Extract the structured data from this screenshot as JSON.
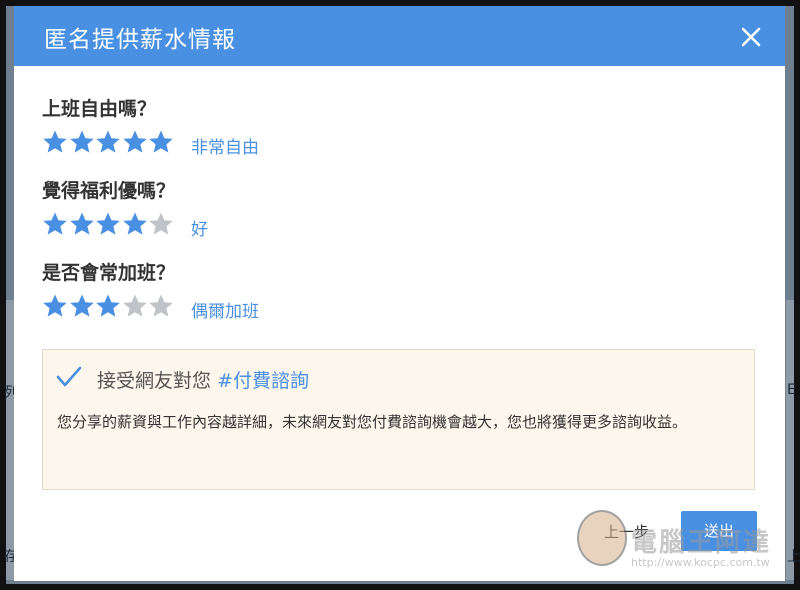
{
  "dialog": {
    "title": "匿名提供薪水情報",
    "close_icon": "close-icon"
  },
  "questions": [
    {
      "question": "上班自由嗎？",
      "rating": 5,
      "max": 5,
      "rating_label": "非常自由"
    },
    {
      "question": "覺得福利優嗎？",
      "rating": 4,
      "max": 5,
      "rating_label": "好"
    },
    {
      "question": "是否會常加班？",
      "rating": 3,
      "max": 5,
      "rating_label": "偶爾加班"
    }
  ],
  "consult": {
    "checked": true,
    "heading_prefix": "接受網友對您",
    "heading_tag": "#付費諮詢",
    "description": "您分享的薪資與工作內容越詳細，未來網友對您付費諮詢機會越大，您也將獲得更多諮詢收益。"
  },
  "footer": {
    "prev_label": "上一步",
    "submit_label": "送出"
  },
  "watermark": {
    "text": "電腦王阿達",
    "url": "http://www.kocpc.com.tw"
  },
  "backdrop": {
    "left_chars": [
      "列",
      "存"
    ],
    "right_chars": [
      "E",
      "上"
    ]
  },
  "colors": {
    "accent": "#4a90e2",
    "star_filled": "#4a90e2",
    "star_empty": "#c0c4c8",
    "consult_bg": "#fdf6ec"
  }
}
